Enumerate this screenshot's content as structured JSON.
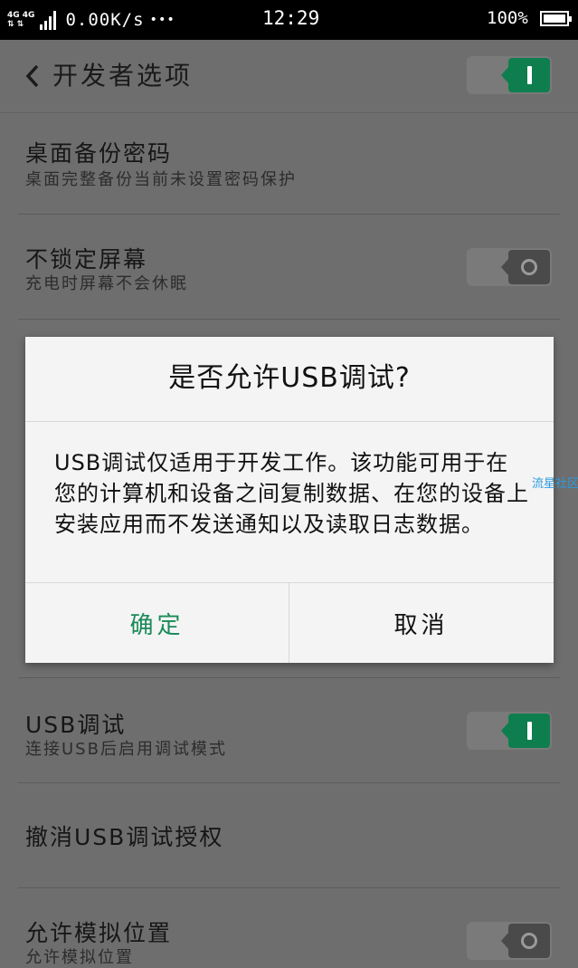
{
  "status_bar": {
    "network_top": "4G 4G",
    "network_bottom": "⇅ ⇅",
    "speed": "0.00K/s",
    "more": "•••",
    "time": "12:29",
    "battery": "100%"
  },
  "header": {
    "title": "开发者选项",
    "toggle_on": true
  },
  "settings": [
    {
      "title": "桌面备份密码",
      "subtitle": "桌面完整备份当前未设置密码保护"
    },
    {
      "title": "不锁定屏幕",
      "subtitle": "充电时屏幕不会休眠",
      "toggle_on": false
    },
    {
      "title": "USB调试",
      "subtitle": "连接USB后启用调试模式",
      "toggle_on": true
    },
    {
      "title": "撤消USB调试授权"
    },
    {
      "title": "允许模拟位置",
      "subtitle": "允许模拟位置",
      "toggle_on": false
    }
  ],
  "dialog": {
    "title": "是否允许USB调试?",
    "message": "USB调试仅适用于开发工作。该功能可用于在您的计算机和设备之间复制数据、在您的设备上安装应用而不发送通知以及读取日志数据。",
    "ok_label": "确定",
    "cancel_label": "取消",
    "ok_color": "#1a8a58"
  },
  "watermark": "流星社区",
  "colors": {
    "toggle_on": "#0f7e4f",
    "dim_background": "#6e6e6e"
  }
}
